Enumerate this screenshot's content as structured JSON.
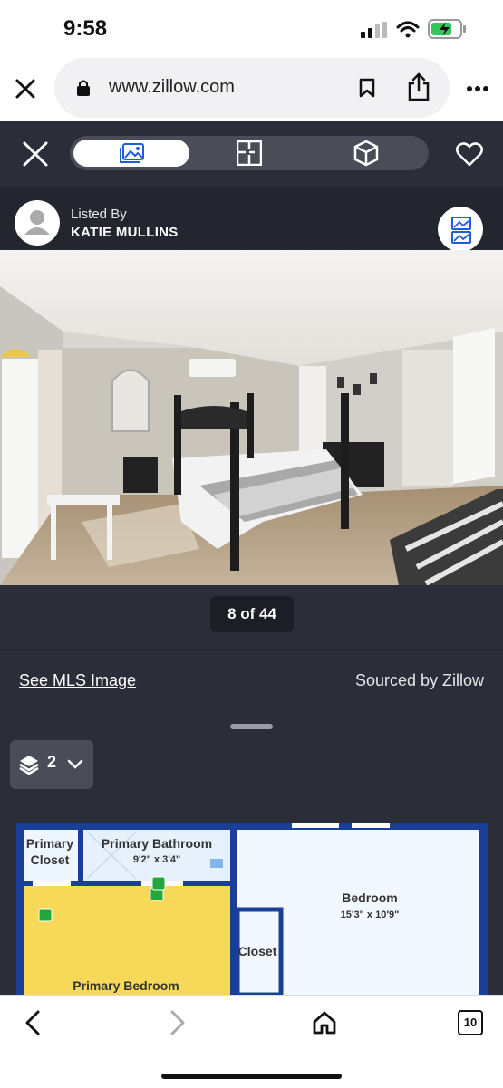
{
  "status_bar": {
    "time": "9:58"
  },
  "browser": {
    "url": "www.zillow.com"
  },
  "toolbar": {
    "tabs": [
      "photos",
      "floor-plan",
      "3d-tour"
    ],
    "active_tab": "photos"
  },
  "listing": {
    "listed_by_label": "Listed By",
    "agent_name": "KATIE MULLINS"
  },
  "photo": {
    "counter": "8 of 44"
  },
  "links": {
    "see_mls": "See MLS Image",
    "sourced_by": "Sourced by Zillow"
  },
  "floorplan": {
    "level": "2",
    "rooms": {
      "primary_closet": [
        "Primary",
        "Closet"
      ],
      "primary_bathroom": "Primary Bathroom",
      "primary_bathroom_dims": "9'2\" x 3'4\"",
      "bedroom": "Bedroom",
      "bedroom_dims": "15'3\" x 10'9\"",
      "closet": "Closet",
      "primary_bedroom": "Primary Bedroom"
    }
  },
  "bottom_bar": {
    "tab_count": "10"
  },
  "colors": {
    "dark_bg": "#2b2d38",
    "accent_blue": "#1e5fd6",
    "fp_yellow": "#f7d95a",
    "fp_blue": "#1a3f99",
    "fp_green": "#22a83a"
  }
}
